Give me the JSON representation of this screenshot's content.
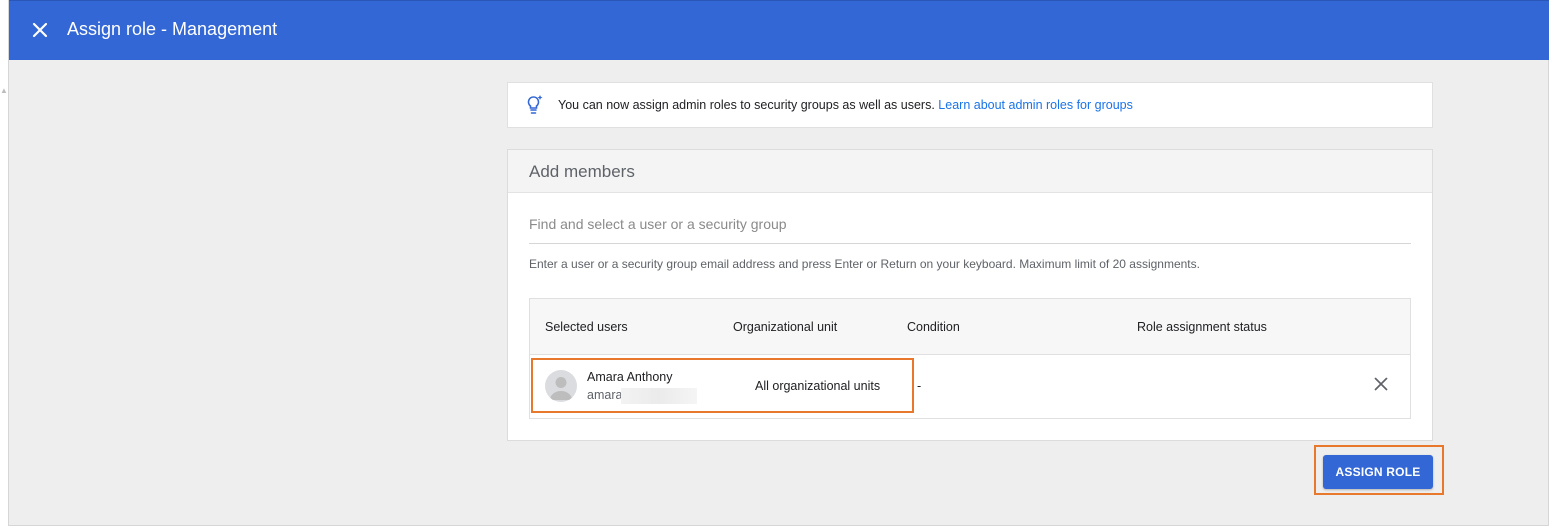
{
  "header": {
    "title": "Assign role - Management",
    "close_icon": "close-icon"
  },
  "tip": {
    "icon": "lightbulb-sparkle-icon",
    "text": "You can now assign admin roles to security groups as well as users. ",
    "link_text": "Learn about admin roles for groups"
  },
  "members": {
    "title": "Add members",
    "search_placeholder": "Find and select a user or a security group",
    "helper": "Enter a user or a security group email address and press Enter or Return on your keyboard. Maximum limit of 20 assignments.",
    "columns": [
      "Selected users",
      "Organizational unit",
      "Condition",
      "Role assignment status"
    ],
    "rows": [
      {
        "avatar_icon": "person-avatar-icon",
        "name": "Amara Anthony",
        "email": "amara",
        "org_unit": "All organizational units",
        "condition": "-",
        "status": "",
        "remove_icon": "close-icon"
      }
    ]
  },
  "actions": {
    "assign_label": "ASSIGN ROLE"
  },
  "colors": {
    "header_bg": "#3367d6",
    "highlight": "#e8782b",
    "link": "#1a73e8",
    "page_bg": "#eeeeee"
  }
}
